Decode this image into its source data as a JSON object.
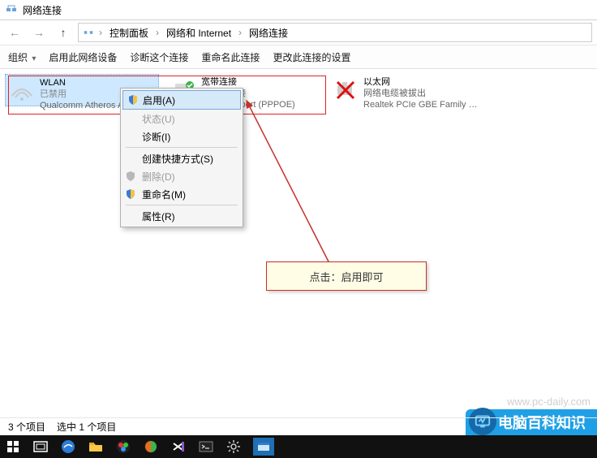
{
  "window": {
    "title": "网络连接"
  },
  "breadcrumb": {
    "crumb1": "控制面板",
    "crumb2": "网络和 Internet",
    "crumb3": "网络连接"
  },
  "toolbar": {
    "organize": "组织",
    "enable": "启用此网络设备",
    "diagnose": "诊断这个连接",
    "rename": "重命名此连接",
    "change_settings": "更改此连接的设置"
  },
  "adapters": {
    "wlan": {
      "name": "WLAN",
      "status": "已禁用",
      "device": "Qualcomm Atheros AR..."
    },
    "broadband": {
      "name": "宽带连接",
      "status": "已断开连接",
      "device": "WAN Miniport (PPPOE)"
    },
    "ethernet": {
      "name": "以太网",
      "status": "网络电缆被拔出",
      "device": "Realtek PCIe GBE Family Contr..."
    }
  },
  "context_menu": {
    "enable": "启用(A)",
    "status": "状态(U)",
    "diagnose": "诊断(I)",
    "create_shortcut": "创建快捷方式(S)",
    "delete": "删除(D)",
    "rename": "重命名(M)",
    "properties": "属性(R)"
  },
  "annotation": {
    "text": "点击：启用即可"
  },
  "statusbar": {
    "item_count": "3 个项目",
    "selected": "选中 1 个项目"
  },
  "watermark": {
    "brand": "电脑百科知识",
    "url": "www.pc-daily.com"
  }
}
